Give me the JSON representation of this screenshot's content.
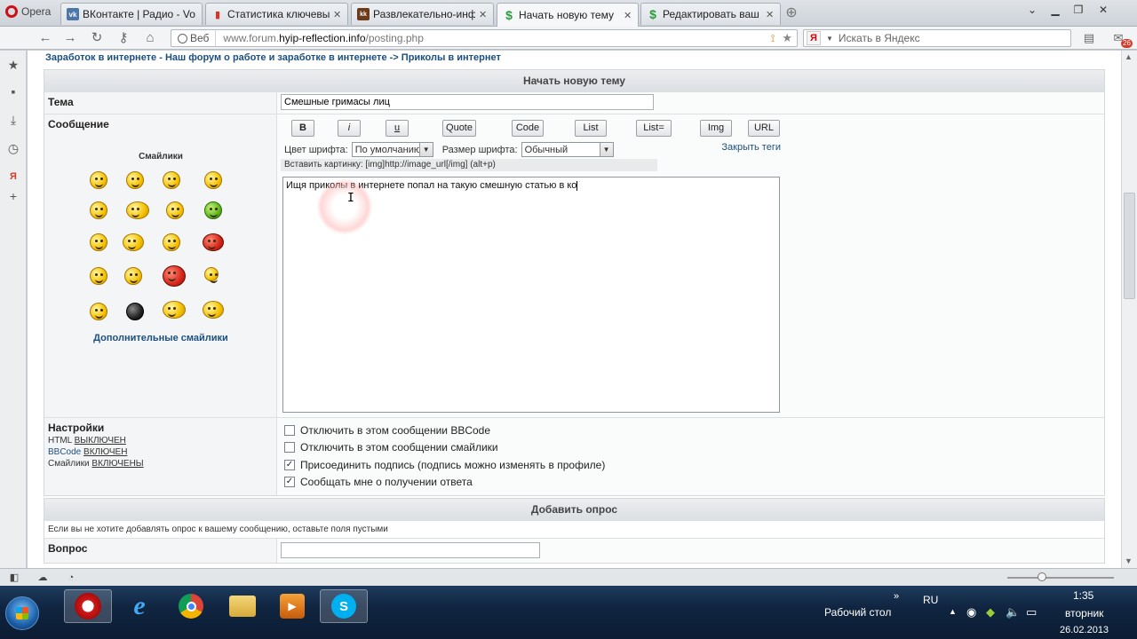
{
  "browser": {
    "menu_label": "Opera",
    "tabs": [
      {
        "label": "ВКонтакте | Радио - Vo...",
        "icon": "vk-icon"
      },
      {
        "label": "Статистика ключевых ...",
        "icon": "stats-icon"
      },
      {
        "label": "Развлекательно-инфо...",
        "icon": "site-icon"
      },
      {
        "label": "Начать новую тему",
        "icon": "dollar-icon"
      },
      {
        "label": "Редактировать ваш пр...",
        "icon": "dollar-icon"
      }
    ],
    "address": {
      "site_label": "Веб",
      "url_prefix": "www.forum.",
      "url_domain": "hyip-reflection.info",
      "url_path": "/posting.php"
    },
    "search_placeholder": "Искать в Яндекс",
    "mail_badge": "26"
  },
  "page": {
    "breadcrumb": {
      "part1": "Заработок в интернете - Наш форум о работе и заработке в интернете",
      "separator": "->",
      "part2": "Приколы в интернет"
    },
    "new_topic_header": "Начать новую тему",
    "topic_label": "Тема",
    "topic_value": "Смешные гримасы лиц",
    "message_label": "Сообщение",
    "smilies_title": "Смайлики",
    "more_smilies": "Дополнительные смайлики",
    "bbcode_buttons": [
      "B",
      "i",
      "u",
      "Quote",
      "Code",
      "List",
      "List=",
      "Img",
      "URL"
    ],
    "font_color_label": "Цвет шрифта:",
    "font_color_value": "По умолчанию",
    "font_size_label": "Размер шрифта:",
    "font_size_value": "Обычный",
    "close_tags": "Закрыть теги",
    "hint": "Вставить картинку: [img]http://image_url[/img]  (alt+p)",
    "message_text": "Ищя приколы в интернете попал на такую смешную статью в ко",
    "settings_label": "Настройки",
    "settings_html_label": "HTML",
    "settings_html_value": "ВЫКЛЮЧЕН",
    "settings_bbcode_label": "BBCode",
    "settings_bbcode_value": "ВКЛЮЧЕН",
    "settings_smilies_label": "Смайлики",
    "settings_smilies_value": "ВКЛЮЧЕНЫ",
    "options": [
      {
        "label": "Отключить в этом сообщении BBCode",
        "checked": false
      },
      {
        "label": "Отключить в этом сообщении смайлики",
        "checked": false
      },
      {
        "label": "Присоединить подпись (подпись можно изменять в профиле)",
        "checked": true
      },
      {
        "label": "Сообщать мне о получении ответа",
        "checked": true
      }
    ],
    "poll_header": "Добавить опрос",
    "poll_note": "Если вы не хотите добавлять опрос к вашему сообщению, оставьте поля пустыми",
    "question_label": "Вопрос",
    "question_value": ""
  },
  "taskbar": {
    "desktop_label": "Рабочий стол",
    "lang": "RU",
    "time": "1:35",
    "day": "вторник",
    "date": "26.02.2013"
  },
  "colors": {
    "link": "#1d4f7e",
    "opera_red": "#cc0f16"
  }
}
